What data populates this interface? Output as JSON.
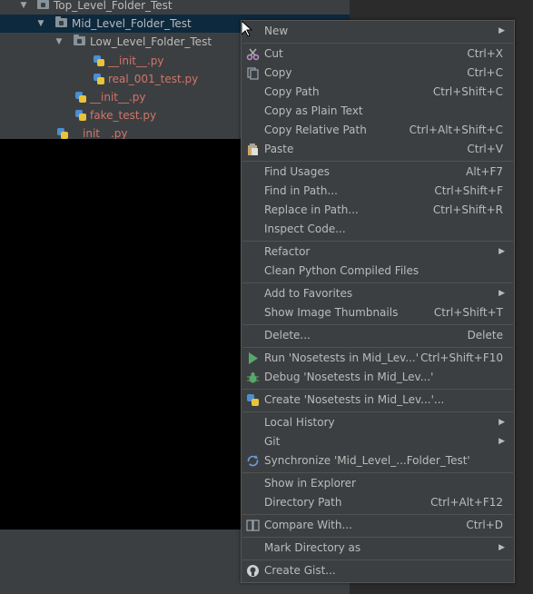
{
  "tree": {
    "rows": [
      {
        "label": "Top_Level_Folder_Test",
        "expand": "▼",
        "icon": "folder-icon"
      },
      {
        "label": "Mid_Level_Folder_Test",
        "expand": "▼",
        "icon": "folder-icon"
      },
      {
        "label": "Low_Level_Folder_Test",
        "expand": "▼",
        "icon": "folder-icon"
      },
      {
        "label": "__init__.py",
        "icon": "python-file-icon"
      },
      {
        "label": "real_001_test.py",
        "icon": "python-file-icon"
      },
      {
        "label": "__init__.py",
        "icon": "python-file-icon"
      },
      {
        "label": "fake_test.py",
        "icon": "python-file-icon"
      },
      {
        "label": "__init__.py",
        "icon": "python-file-icon"
      }
    ]
  },
  "menu": {
    "new": {
      "label": "New",
      "arrow": "▶"
    },
    "cut": {
      "label": "Cut",
      "shortcut": "Ctrl+X",
      "icon": "scissors-icon"
    },
    "copy": {
      "label": "Copy",
      "shortcut": "Ctrl+C",
      "icon": "copy-icon"
    },
    "copy_path": {
      "label": "Copy Path",
      "shortcut": "Ctrl+Shift+C"
    },
    "copy_plain": {
      "label": "Copy as Plain Text"
    },
    "copy_relative": {
      "label": "Copy Relative Path",
      "shortcut": "Ctrl+Alt+Shift+C"
    },
    "paste": {
      "label": "Paste",
      "shortcut": "Ctrl+V",
      "icon": "clipboard-icon"
    },
    "find_usages": {
      "label": "Find Usages",
      "shortcut": "Alt+F7"
    },
    "find_in_path": {
      "label": "Find in Path...",
      "shortcut": "Ctrl+Shift+F"
    },
    "replace_in_path": {
      "label": "Replace in Path...",
      "shortcut": "Ctrl+Shift+R"
    },
    "inspect_code": {
      "label": "Inspect Code..."
    },
    "refactor": {
      "label": "Refactor",
      "arrow": "▶"
    },
    "clean_python": {
      "label": "Clean Python Compiled Files"
    },
    "add_favorites": {
      "label": "Add to Favorites",
      "arrow": "▶"
    },
    "show_thumbnails": {
      "label": "Show Image Thumbnails",
      "shortcut": "Ctrl+Shift+T"
    },
    "delete": {
      "label": "Delete...",
      "shortcut": "Delete"
    },
    "run": {
      "label": "Run 'Nosetests in Mid_Lev...'",
      "shortcut": "Ctrl+Shift+F10",
      "icon": "run-icon"
    },
    "debug": {
      "label": "Debug 'Nosetests in Mid_Lev...'",
      "icon": "bug-icon"
    },
    "create": {
      "label": "Create 'Nosetests in Mid_Lev...'...",
      "icon": "python-icon"
    },
    "local_history": {
      "label": "Local History",
      "arrow": "▶"
    },
    "git": {
      "label": "Git",
      "arrow": "▶"
    },
    "synchronize": {
      "label": "Synchronize 'Mid_Level_...Folder_Test'",
      "icon": "sync-icon"
    },
    "show_explorer": {
      "label": "Show in Explorer"
    },
    "directory_path": {
      "label": "Directory Path",
      "shortcut": "Ctrl+Alt+F12"
    },
    "compare_with": {
      "label": "Compare With...",
      "shortcut": "Ctrl+D",
      "icon": "compare-icon"
    },
    "mark_directory": {
      "label": "Mark Directory as",
      "arrow": "▶"
    },
    "create_gist": {
      "label": "Create Gist...",
      "icon": "github-icon"
    }
  },
  "colors": {
    "panel_bg": "#3c3f41",
    "selection_bg": "#0d293e",
    "text": "#bbbbbb",
    "python_file_text": "#d3746a",
    "run_green": "#59a869",
    "separator": "#515151"
  }
}
